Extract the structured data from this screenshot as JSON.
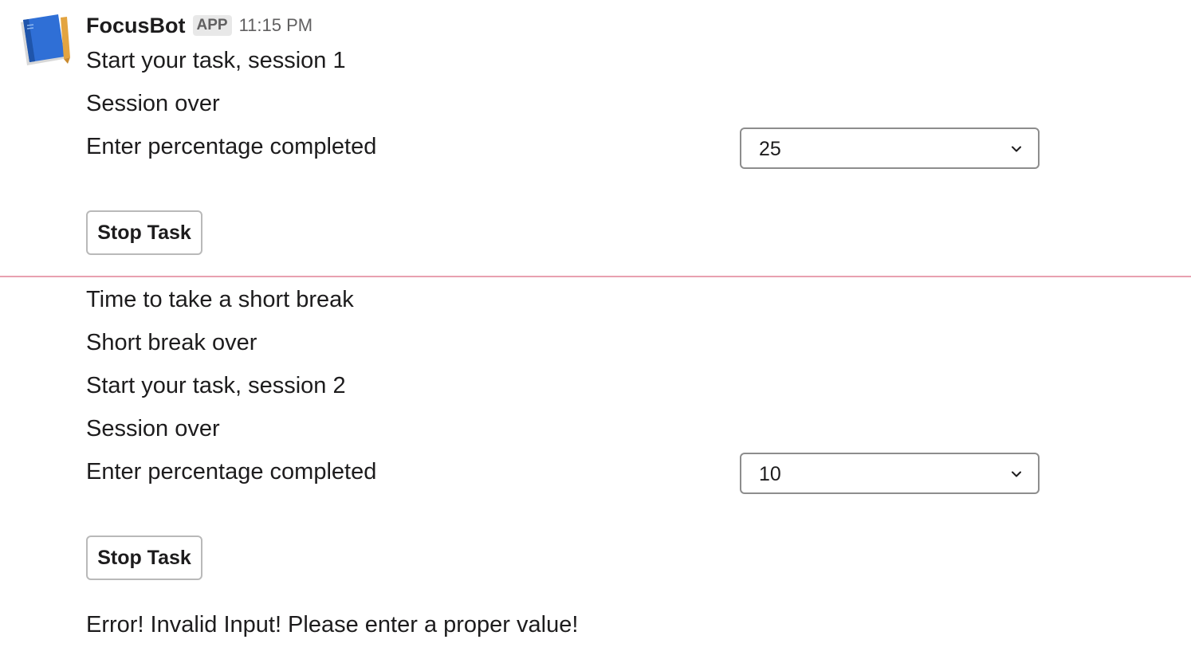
{
  "message": {
    "bot_name": "FocusBot",
    "badge": "APP",
    "timestamp": "11:15 PM",
    "avatar_icon": "notebook-icon"
  },
  "block1": {
    "line1": "Start your task, session 1",
    "line2": "Session over",
    "prompt": "Enter percentage completed",
    "select_value": "25",
    "stop_button": "Stop Task"
  },
  "block2": {
    "line1": "Time to take a short break",
    "line2": "Short break over",
    "line3": "Start your task, session 2",
    "line4": "Session over",
    "prompt": "Enter percentage completed",
    "select_value": "10",
    "stop_button": "Stop Task",
    "error": "Error! Invalid Input! Please enter a proper value!"
  },
  "colors": {
    "divider": "#e8a0b0",
    "text": "#1d1c1d",
    "muted": "#616061"
  }
}
